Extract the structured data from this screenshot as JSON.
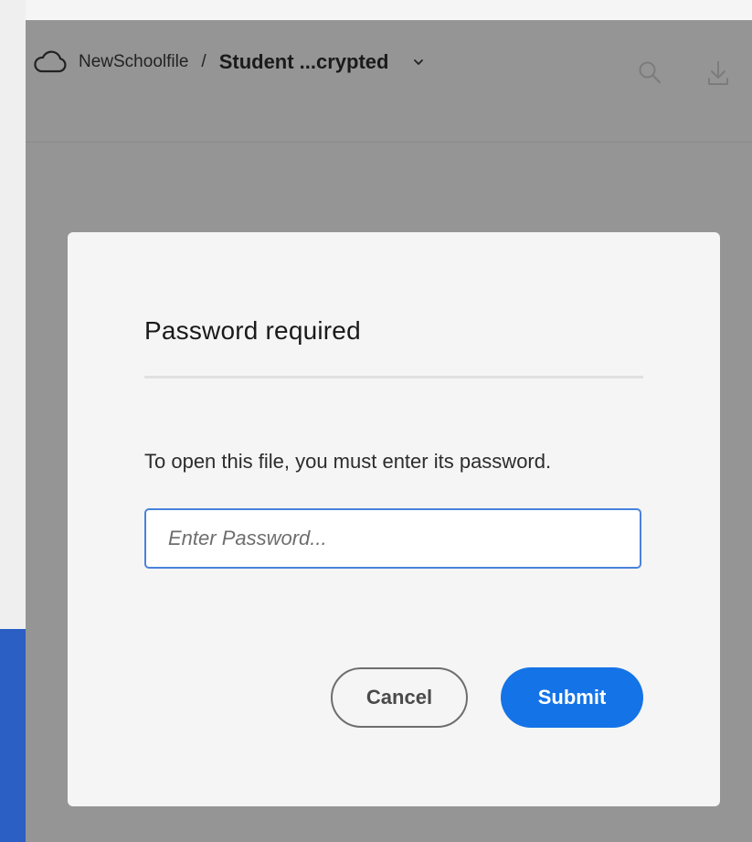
{
  "header": {
    "breadcrumb": {
      "parent_label": "NewSchoolfile",
      "separator": "/",
      "current_label": "Student ...crypted"
    },
    "icons": {
      "cloud": "cloud-icon",
      "chevron": "chevron-down-icon",
      "search": "search-icon",
      "download": "download-icon"
    }
  },
  "dialog": {
    "title": "Password required",
    "message": "To open this file, you must enter its password.",
    "password_input": {
      "value": "",
      "placeholder": "Enter Password..."
    },
    "cancel_label": "Cancel",
    "submit_label": "Submit"
  },
  "colors": {
    "accent": "#1473e6",
    "input_focus_border": "#4a82dc",
    "overlay": "#959595",
    "sidebar_blue": "#2b5fc4"
  }
}
